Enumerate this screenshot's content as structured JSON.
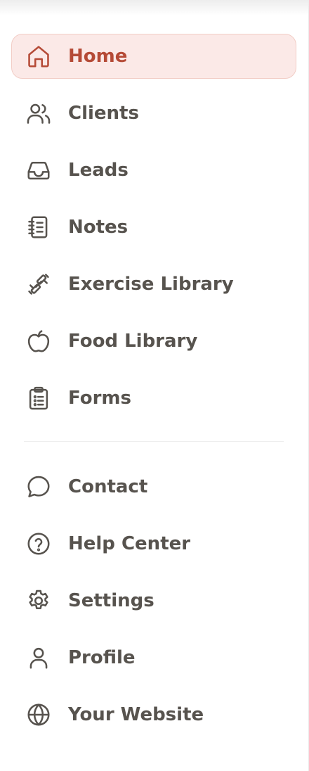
{
  "sidebar": {
    "primary": [
      {
        "label": "Home",
        "icon": "home-icon"
      },
      {
        "label": "Clients",
        "icon": "users-icon"
      },
      {
        "label": "Leads",
        "icon": "inbox-icon"
      },
      {
        "label": "Notes",
        "icon": "notebook-icon"
      },
      {
        "label": "Exercise Library",
        "icon": "dumbbell-icon"
      },
      {
        "label": "Food Library",
        "icon": "apple-icon"
      },
      {
        "label": "Forms",
        "icon": "clipboard-list-icon"
      }
    ],
    "secondary": [
      {
        "label": "Contact",
        "icon": "chat-bubble-icon"
      },
      {
        "label": "Help Center",
        "icon": "question-circle-icon"
      },
      {
        "label": "Settings",
        "icon": "gear-icon"
      },
      {
        "label": "Profile",
        "icon": "user-icon"
      },
      {
        "label": "Your Website",
        "icon": "globe-icon"
      }
    ]
  },
  "colors": {
    "accent": "#b54a36",
    "active_background": "#fbe9e7",
    "active_border": "#f2cdc6",
    "text": "#57534e"
  }
}
